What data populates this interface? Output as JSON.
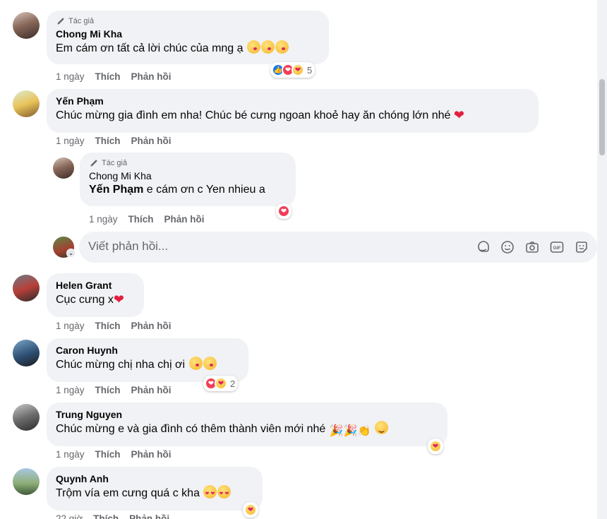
{
  "author_badge": "Tác giả",
  "action_like": "Thích",
  "action_reply": "Phản hồi",
  "comments": [
    {
      "name": "Chong Mi Kha",
      "text": "Em cám ơn tất cả lời chúc của mng ạ",
      "time": "1 ngày",
      "reaction_count": "5"
    },
    {
      "name": "Yến Phạm",
      "text": "Chúc mừng gia đình em nha! Chúc bé cưng ngoan khoẻ hay ăn chóng lớn nhé",
      "time": "1 ngày"
    },
    {
      "name": "Chong Mi Kha",
      "mention": "Yến Phạm",
      "text": " e cám ơn c Yen nhieu a",
      "time": "1 ngày"
    },
    {
      "name": "Helen Grant",
      "text": "Cục cưng x",
      "time": "1 ngày"
    },
    {
      "name": "Caron Huynh",
      "text": "Chúc mừng chị nha chị ơi",
      "time": "1 ngày",
      "reaction_count": "2"
    },
    {
      "name": "Trung Nguyen",
      "text": "Chúc mừng e và gia đình có thêm thành viên mới nhé",
      "time": "1 ngày"
    },
    {
      "name": "Quynh Anh",
      "text": "Trộm vía em cưng quá c kha",
      "time": "22 giờ"
    }
  ],
  "reply_box": {
    "placeholder": "Viết phản hồi..."
  },
  "icons": [
    "pencil-icon",
    "sticker-icon",
    "emoji-icon",
    "camera-icon",
    "gif-icon",
    "avatar-sticker-icon"
  ],
  "colors": {
    "bubble": "#f0f2f5",
    "secondary_text": "#65676b",
    "like_blue": "#1877f2",
    "love_red": "#f33e58",
    "heart": "#e41e3f"
  }
}
